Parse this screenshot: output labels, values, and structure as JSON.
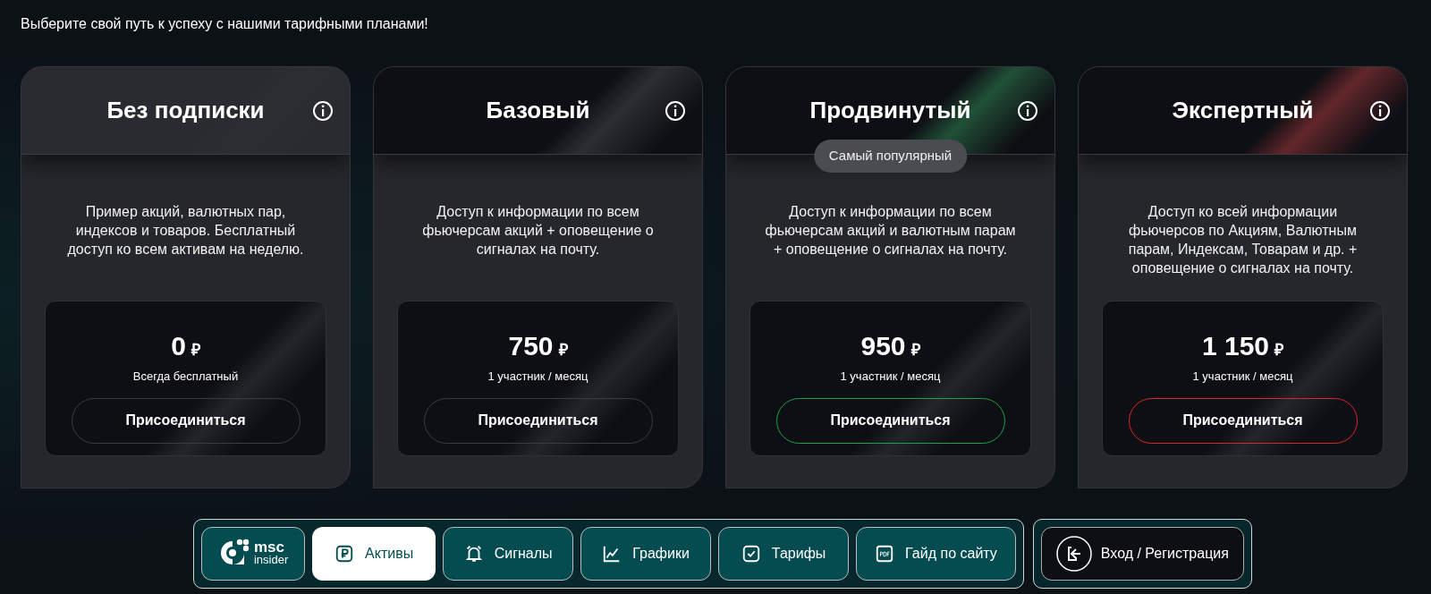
{
  "heading": "Выберите свой путь к успеху с нашими тарифными планами!",
  "plans": [
    {
      "title": "Без подписки",
      "current": true,
      "color": "#3a3b42",
      "description": "Пример акций, валютных пар, индексов и товаров. Бесплатный доступ ко всем активам на неделю.",
      "price": "0",
      "currency": "₽",
      "period": "Всегда бесплатный",
      "button": "Присоединиться"
    },
    {
      "title": "Базовый",
      "current": false,
      "color": "#3a3b42",
      "description": "Доступ к информации по всем фьючерсам акций + оповещение о сигналах на почту.",
      "price": "750",
      "currency": "₽",
      "period": "1 участник / месяц",
      "button": "Присоединиться"
    },
    {
      "title": "Продвинутый",
      "current": false,
      "color": "#16a34a",
      "badge": "Самый популярный",
      "description": "Доступ к информации по всем фьючерсам акций и валютным парам + оповещение о сигналах на почту.",
      "price": "950",
      "currency": "₽",
      "period": "1 участник / месяц",
      "button": "Присоединиться"
    },
    {
      "title": "Экспертный",
      "current": false,
      "color": "#dc2626",
      "description": "Доступ ко всей информации фьючерсов по Акциям, Валютным парам, Индексам, Товарам и др. + оповещение о сигналах на почту.",
      "price": "1 150",
      "currency": "₽",
      "period": "1 участник / месяц",
      "button": "Присоединиться"
    }
  ],
  "nav": {
    "logo": {
      "line1": "msc",
      "line2": "insider"
    },
    "items": [
      {
        "label": "Активы",
        "kind": "ruble",
        "selected": true
      },
      {
        "label": "Сигналы",
        "kind": "bell",
        "selected": false
      },
      {
        "label": "Графики",
        "kind": "chart",
        "selected": false
      },
      {
        "label": "Тарифы",
        "kind": "check",
        "selected": false
      },
      {
        "label": "Гайд по сайту",
        "kind": "pdf",
        "selected": false
      }
    ],
    "login": "Вход / Регистрация"
  }
}
